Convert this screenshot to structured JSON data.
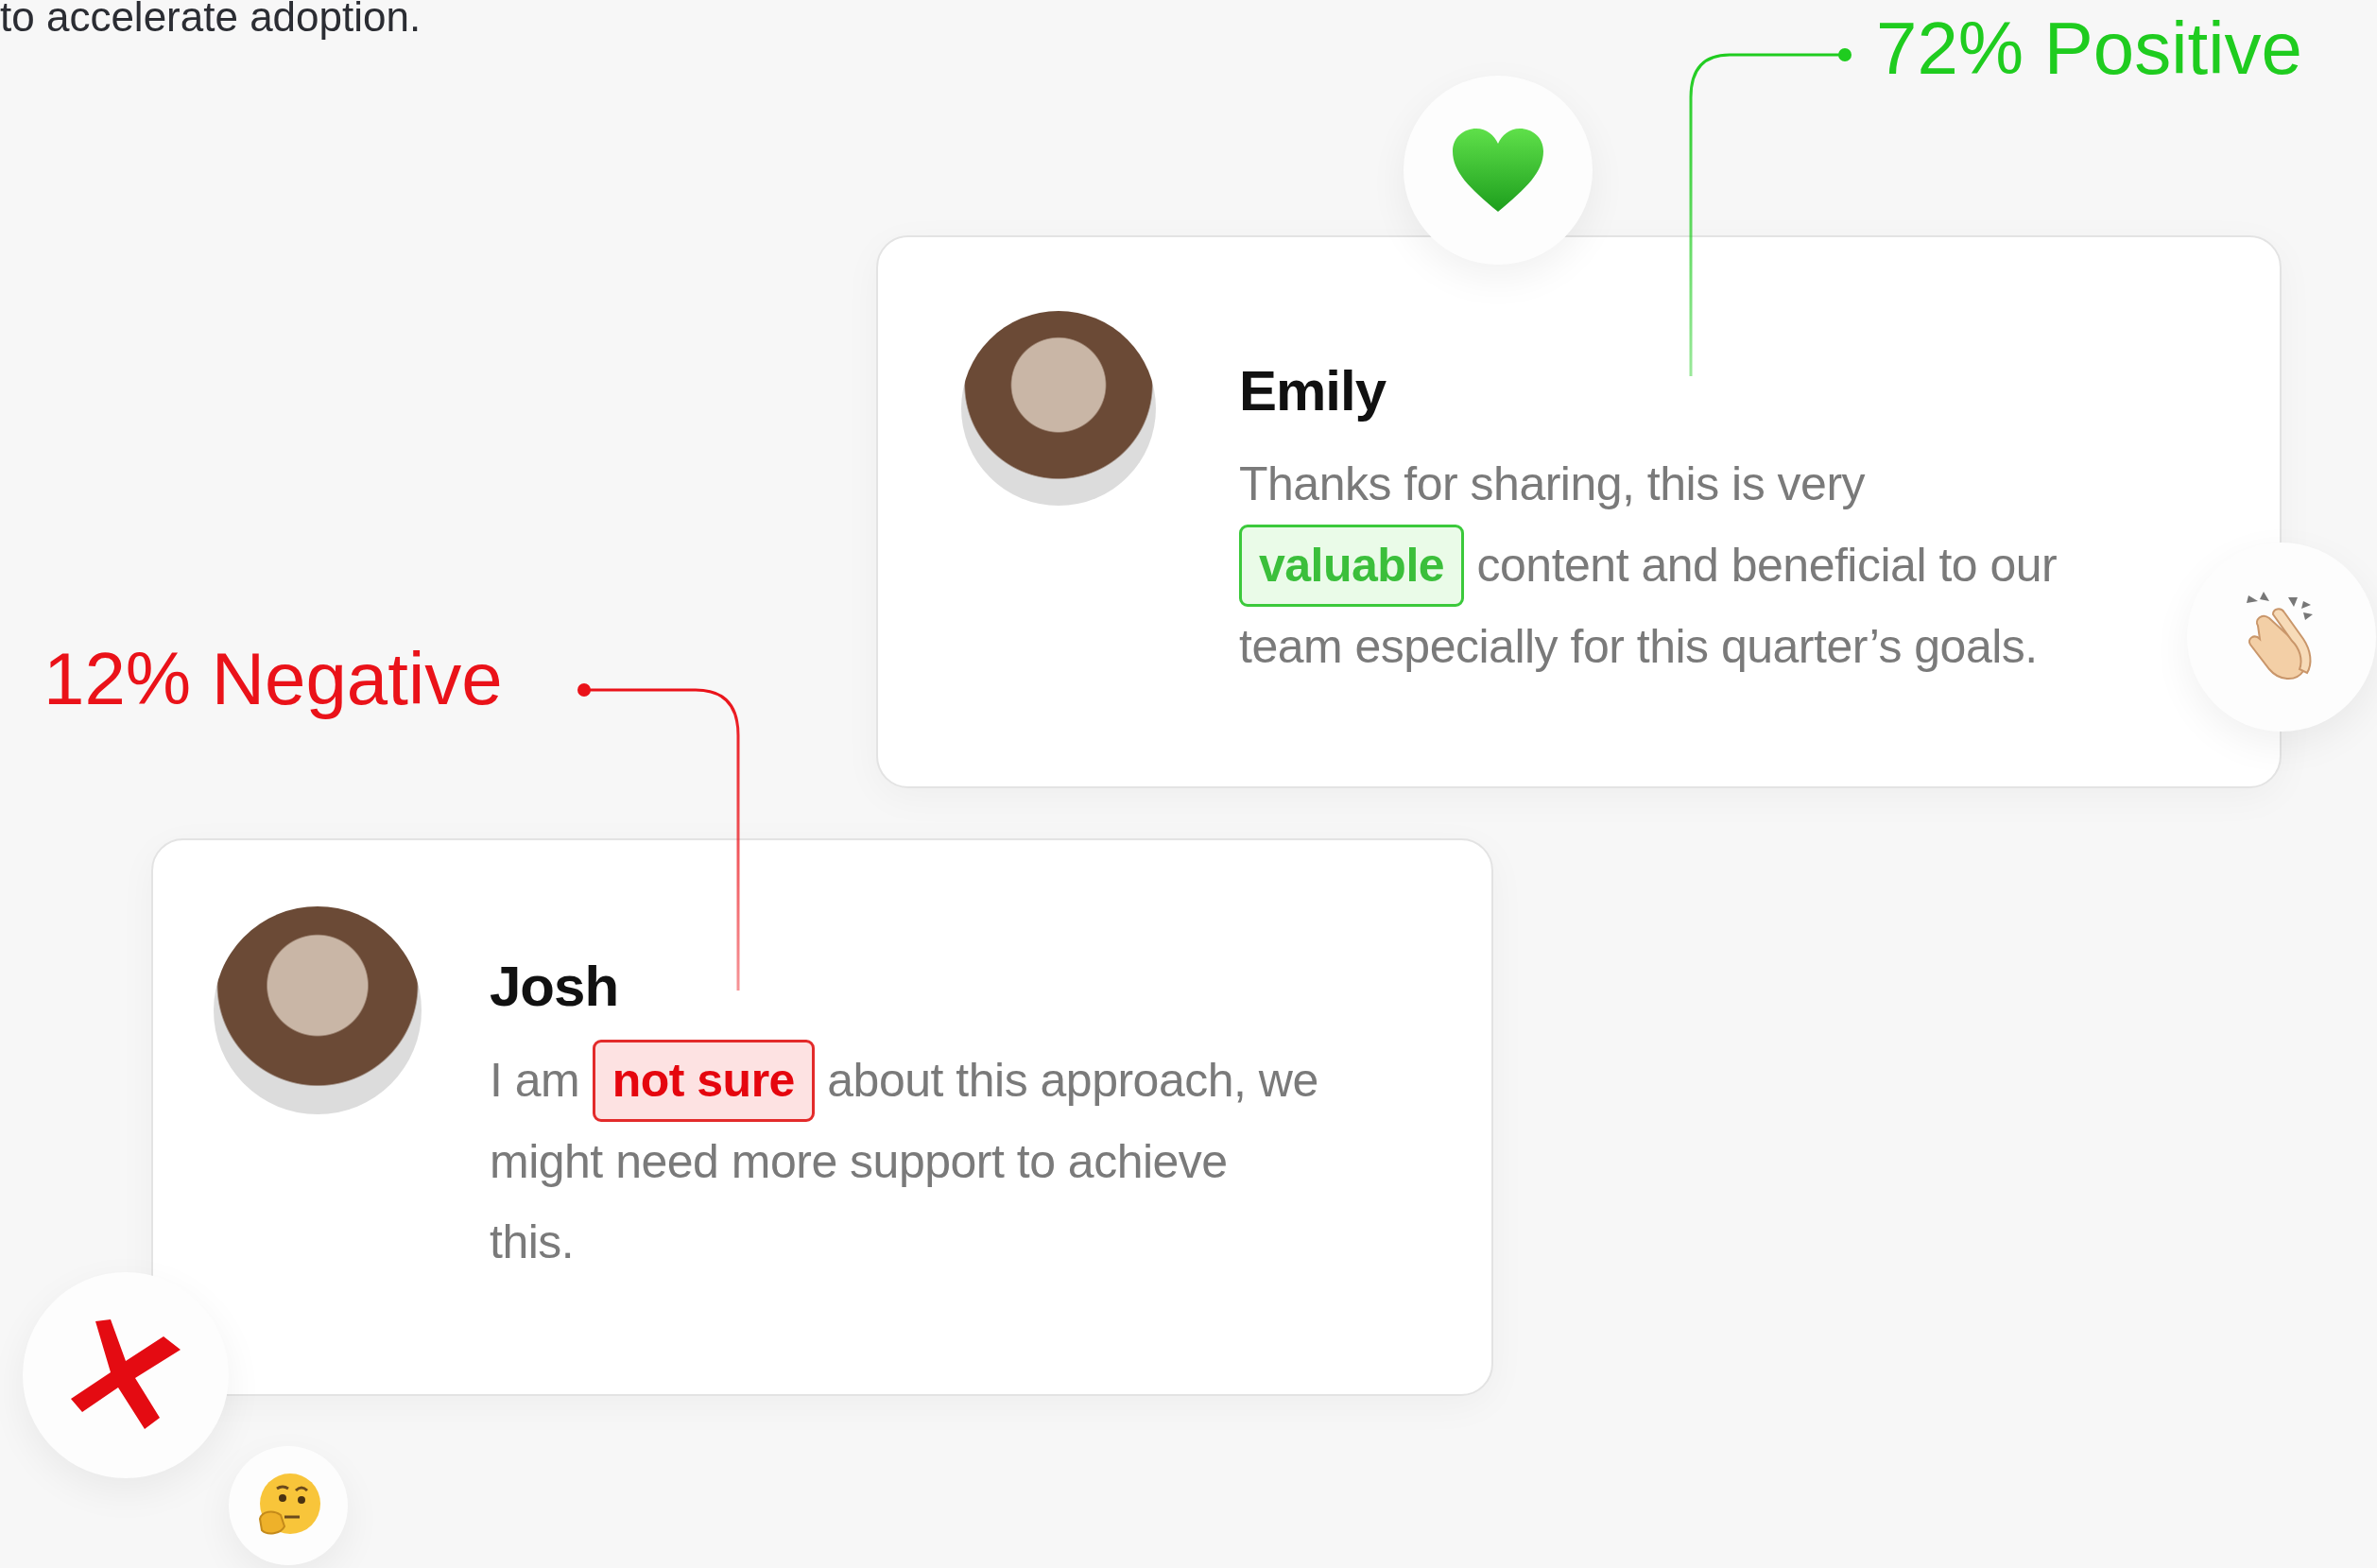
{
  "intro_text": "to accelerate adoption.",
  "sentiments": [
    {
      "kind": "positive",
      "label": "72% Positive"
    },
    {
      "kind": "negative",
      "label": "12% Negative"
    }
  ],
  "comments": [
    {
      "kind": "positive",
      "name": "Emily",
      "before": "Thanks for sharing, this is very",
      "highlight": "valuable",
      "after": "content and beneficial to our team especially for this quarter’s goals."
    },
    {
      "kind": "negative",
      "name": "Josh",
      "before": "I am",
      "highlight": "not sure",
      "after": "about this approach, we might need more support to achieve this."
    }
  ]
}
